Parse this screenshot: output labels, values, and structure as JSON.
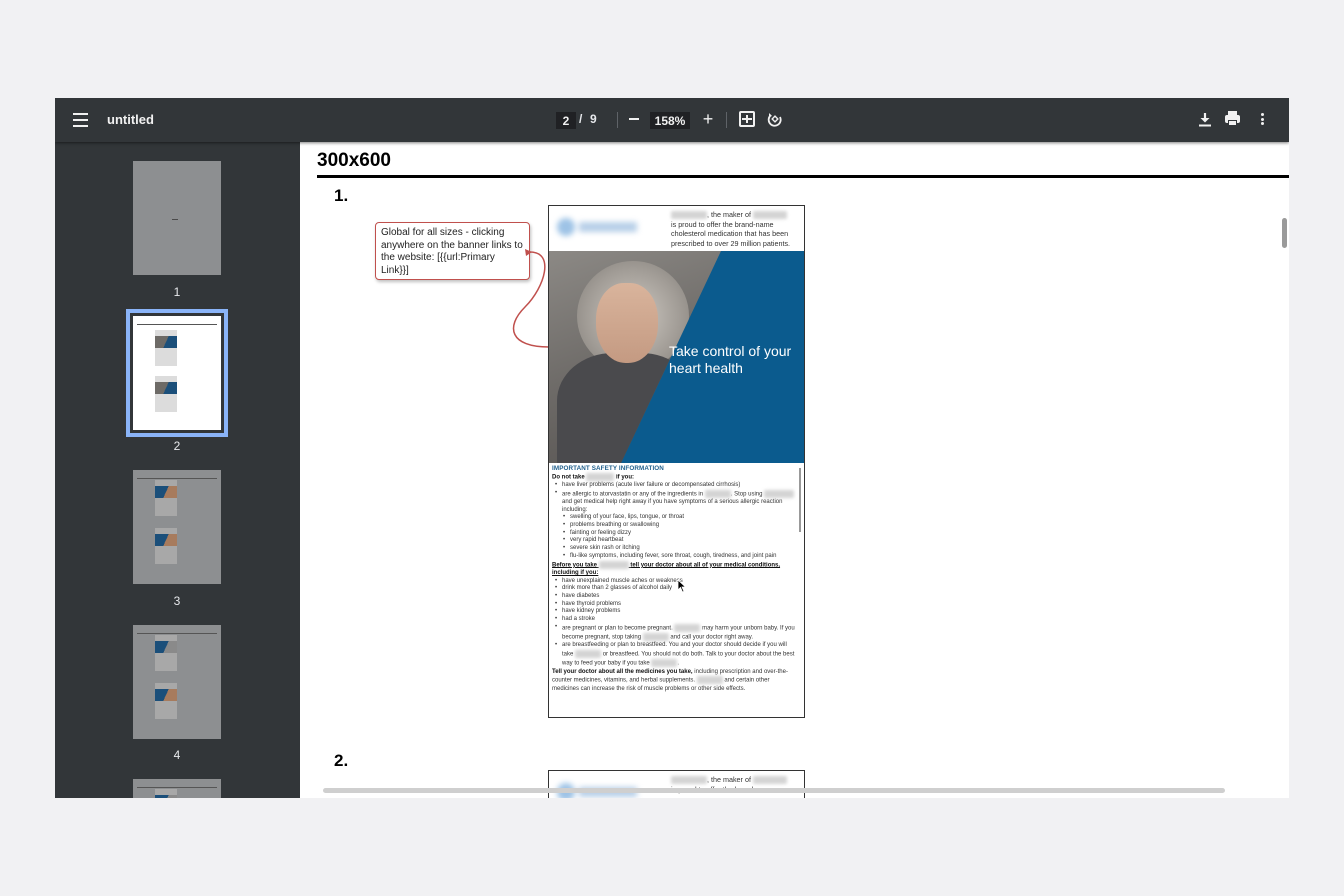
{
  "toolbar": {
    "title": "untitled",
    "current_page": "2",
    "page_separator": "/",
    "total_pages": "9",
    "zoom": "158%",
    "zoom_in_label": "+",
    "zoom_out_label": "−"
  },
  "sidebar": {
    "thumbnails": [
      {
        "label": "1",
        "selected": false
      },
      {
        "label": "2",
        "selected": true
      },
      {
        "label": "3",
        "selected": false
      },
      {
        "label": "4",
        "selected": false
      }
    ]
  },
  "document": {
    "heading": "300x600",
    "items": [
      {
        "number": "1."
      },
      {
        "number": "2."
      }
    ],
    "callout": "Global for all sizes - clicking anywhere on the banner links to the website: [{{url:Primary Link}}]",
    "banner": {
      "top_text_1": ", the maker of",
      "top_text_2": "is proud to offer the brand-name cholesterol medication that has been prescribed to over 29 million patients.",
      "hero_text": "Take control of your heart health",
      "isi_title": "IMPORTANT SAFETY INFORMATION",
      "do_not_take_prefix": "Do not take",
      "do_not_take_suffix": "if you:",
      "list_a": [
        "have liver problems (acute liver failure or decompensated cirrhosis)",
        "are allergic to atorvastatin or any of the ingredients in",
        "and get medical help right away if you have symptoms of a serious allergic reaction including:"
      ],
      "list_a_stop": ". Stop using",
      "list_sub": [
        "swelling of your face, lips, tongue, or throat",
        "problems breathing or swallowing",
        "fainting or feeling dizzy",
        "very rapid heartbeat",
        "severe skin rash or itching",
        "flu-like symptoms, including fever, sore throat, cough, tiredness, and joint pain"
      ],
      "before_prefix": "Before you take",
      "before_suffix": "tell your doctor about all of your medical conditions, including if you:",
      "list_b": [
        "have unexplained muscle aches or weakness",
        "drink more than 2 glasses of alcohol daily",
        "have diabetes",
        "have thyroid problems",
        "have kidney problems",
        "had a stroke"
      ],
      "pregnant_1": "are pregnant or plan to become pregnant.",
      "pregnant_2": "may harm your unborn baby. If you become pregnant, stop taking",
      "pregnant_3": "and call your doctor right away.",
      "breastfeeding_1": "are breastfeeding or plan to breastfeed. You and your doctor should decide if you will take",
      "breastfeeding_2": "or breastfeed. You should not do both. Talk to your doctor about the best way to feed your baby if you take",
      "breastfeeding_3": ".",
      "tell_bold": "Tell your doctor about all the medicines you take,",
      "tell_rest_1": "including prescription and over-the-counter medicines, vitamins, and herbal supplements.",
      "tell_rest_2": "and certain other medicines can increase the risk of muscle problems or other side effects."
    },
    "banner2": {
      "top_text_1": ", the maker of",
      "top_text_2": "is proud to offer the brand-name"
    }
  }
}
